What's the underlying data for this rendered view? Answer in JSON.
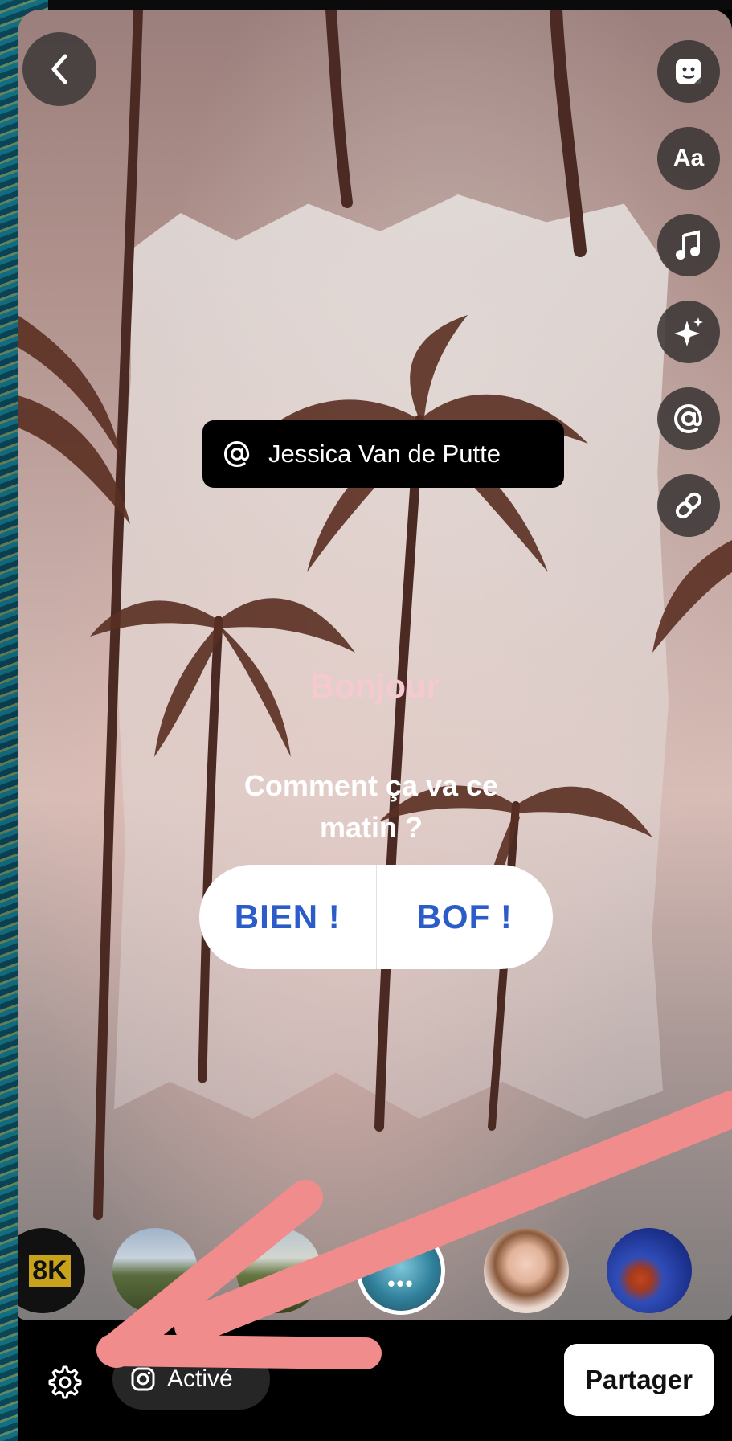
{
  "story": {
    "mention": "Jessica Van de Putte",
    "title": "Bonjour",
    "question": "Comment ça va ce matin ?",
    "poll": {
      "option_a": "BIEN !",
      "option_b": "BOF !"
    }
  },
  "tools": [
    {
      "icon": "sticker-icon"
    },
    {
      "icon": "text-icon",
      "label": "Aa"
    },
    {
      "icon": "music-icon"
    },
    {
      "icon": "effects-icon"
    },
    {
      "icon": "mention-icon"
    },
    {
      "icon": "link-icon"
    }
  ],
  "tray": {
    "thumbs": [
      "8k-thumbnail",
      "landscape-thumbnail",
      "landscape-thumbnail",
      "selected-thumbnail",
      "portrait-thumbnail",
      "blue-thumbnail"
    ],
    "first_label": "8K",
    "selected_more": "•••"
  },
  "bottom": {
    "active_label": "Activé",
    "share_label": "Partager"
  },
  "colors": {
    "poll_text": "#2b5cc7",
    "title_pink": "#f4c9cf",
    "arrow": "#f08c8c"
  }
}
